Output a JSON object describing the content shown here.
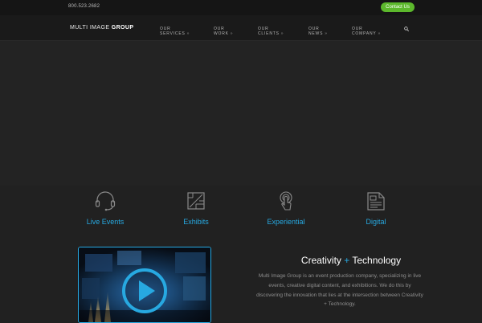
{
  "topbar": {
    "phone": "800.523.2682",
    "contact_label": "Contact Us"
  },
  "header": {
    "logo_regular": "MULTI IMAGE ",
    "logo_bold": "GROUP",
    "nav": [
      {
        "line1": "OUR",
        "line2": "SERVICES"
      },
      {
        "line1": "OUR",
        "line2": "WORK"
      },
      {
        "line1": "OUR",
        "line2": "CLIENTS"
      },
      {
        "line1": "OUR",
        "line2": "NEWS"
      },
      {
        "line1": "OUR",
        "line2": "COMPANY"
      }
    ],
    "chevron": "»",
    "search_icon": "search-icon"
  },
  "features": [
    {
      "label": "Live Events",
      "icon": "headset-icon"
    },
    {
      "label": "Exhibits",
      "icon": "blueprint-icon"
    },
    {
      "label": "Experiential",
      "icon": "touch-icon"
    },
    {
      "label": "Digital",
      "icon": "digital-document-icon"
    }
  ],
  "intro": {
    "headline_part1": "Creativity ",
    "headline_plus": "+",
    "headline_part2": " Technology",
    "paragraph": "Multi Image Group is an event production company, specializing in live events, creative digital content, and exhibitions. We do this by discovering the innovation that lies at the intersection between Creativity + Technology."
  },
  "colors": {
    "accent": "#27a9e1",
    "contact_button": "#5cb82c",
    "background": "#212121"
  }
}
